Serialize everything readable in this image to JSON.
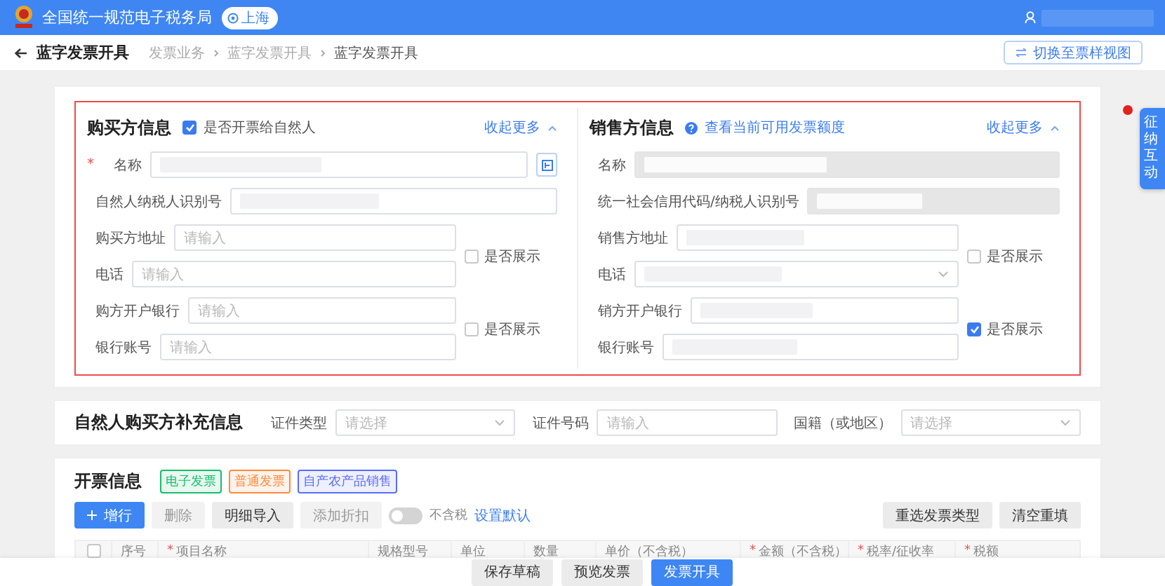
{
  "header": {
    "site_title": "全国统一规范电子税务局",
    "region": "上海"
  },
  "page": {
    "title": "蓝字发票开具",
    "breadcrumbs": [
      "发票业务",
      "蓝字发票开具",
      "蓝字发票开具"
    ],
    "switch_view": "切换至票样视图"
  },
  "buyer": {
    "title": "购买方信息",
    "natural_person": {
      "label": "是否开票给自然人",
      "checked": true
    },
    "collapse": "收起更多",
    "groups": [
      {
        "fields": [
          {
            "label": "名称",
            "required_mark": "*",
            "kind": "lookup",
            "masked": true,
            "disabled": false
          }
        ]
      },
      {
        "fields": [
          {
            "label": "自然人纳税人识别号",
            "kind": "input",
            "masked": true,
            "disabled": false
          }
        ]
      },
      {
        "fields": [
          {
            "label": "购买方地址",
            "kind": "input",
            "placeholder": "请输入",
            "masked": false,
            "disabled": false
          },
          {
            "label": "电话",
            "kind": "input",
            "placeholder": "请输入",
            "masked": false,
            "disabled": false
          }
        ],
        "toggle": {
          "label": "是否展示",
          "checked": false
        }
      },
      {
        "fields": [
          {
            "label": "购方开户银行",
            "kind": "input",
            "placeholder": "请输入",
            "masked": false,
            "disabled": false
          },
          {
            "label": "银行账号",
            "kind": "input",
            "placeholder": "请输入",
            "masked": false,
            "disabled": false
          }
        ],
        "toggle": {
          "label": "是否展示",
          "checked": false
        }
      }
    ]
  },
  "seller": {
    "title": "销售方信息",
    "quota_link": "查看当前可用发票额度",
    "collapse": "收起更多",
    "groups": [
      {
        "fields": [
          {
            "label": "名称",
            "kind": "input",
            "masked": true,
            "disabled": true
          }
        ]
      },
      {
        "fields": [
          {
            "label": "统一社会信用代码/纳税人识别号",
            "kind": "input",
            "masked": true,
            "disabled": true
          }
        ]
      },
      {
        "fields": [
          {
            "label": "销售方地址",
            "kind": "input",
            "masked": true,
            "disabled": false
          },
          {
            "label": "电话",
            "kind": "select",
            "masked": true,
            "disabled": false
          }
        ],
        "toggle": {
          "label": "是否展示",
          "checked": false
        }
      },
      {
        "fields": [
          {
            "label": "销方开户银行",
            "kind": "input",
            "masked": true,
            "disabled": false
          },
          {
            "label": "银行账号",
            "kind": "input",
            "masked": true,
            "disabled": false
          }
        ],
        "toggle": {
          "label": "是否展示",
          "checked": true
        }
      }
    ]
  },
  "supplement": {
    "title": "自然人购买方补充信息",
    "fields": [
      {
        "label": "证件类型",
        "kind": "select",
        "placeholder": "请选择"
      },
      {
        "label": "证件号码",
        "kind": "input",
        "placeholder": "请输入"
      },
      {
        "label": "国籍（或地区）",
        "kind": "select",
        "placeholder": "请选择"
      }
    ]
  },
  "invoice": {
    "title": "开票信息",
    "tags": [
      {
        "label": "电子发票",
        "color": "#19be6b"
      },
      {
        "label": "普通发票",
        "color": "#ff8a3d"
      },
      {
        "label": "自产农产品销售",
        "color": "#5b6cff"
      }
    ],
    "toolbar": [
      {
        "label": "增行",
        "kind": "add",
        "disabled": false
      },
      {
        "label": "删除",
        "kind": "default",
        "disabled": true
      },
      {
        "label": "明细导入",
        "kind": "default",
        "disabled": false
      },
      {
        "label": "添加折扣",
        "kind": "default",
        "disabled": true
      }
    ],
    "switch": {
      "label": "不含税",
      "on": false
    },
    "default_link": "设置默认",
    "actions": [
      "重选发票类型",
      "清空重填"
    ],
    "columns": [
      {
        "kind": "checkbox",
        "checked": false
      },
      {
        "kind": "text",
        "label": "序号"
      },
      {
        "kind": "text",
        "label": "项目名称",
        "required_mark": "*"
      },
      {
        "kind": "text",
        "label": "规格型号"
      },
      {
        "kind": "text",
        "label": "单位"
      },
      {
        "kind": "text",
        "label": "数量"
      },
      {
        "kind": "text",
        "label": "单价（不含税）"
      },
      {
        "kind": "text",
        "label": "金额（不含税）",
        "required_mark": "*"
      },
      {
        "kind": "text",
        "label": "税率/征收率",
        "required_mark": "*"
      },
      {
        "kind": "text",
        "label": "税额",
        "required_mark": "*"
      }
    ]
  },
  "footer": [
    {
      "label": "保存草稿",
      "kind": "default"
    },
    {
      "label": "预览发票",
      "kind": "default"
    },
    {
      "label": "发票开具",
      "kind": "primary"
    }
  ],
  "float": {
    "label": "征纳互动",
    "badge": true
  }
}
